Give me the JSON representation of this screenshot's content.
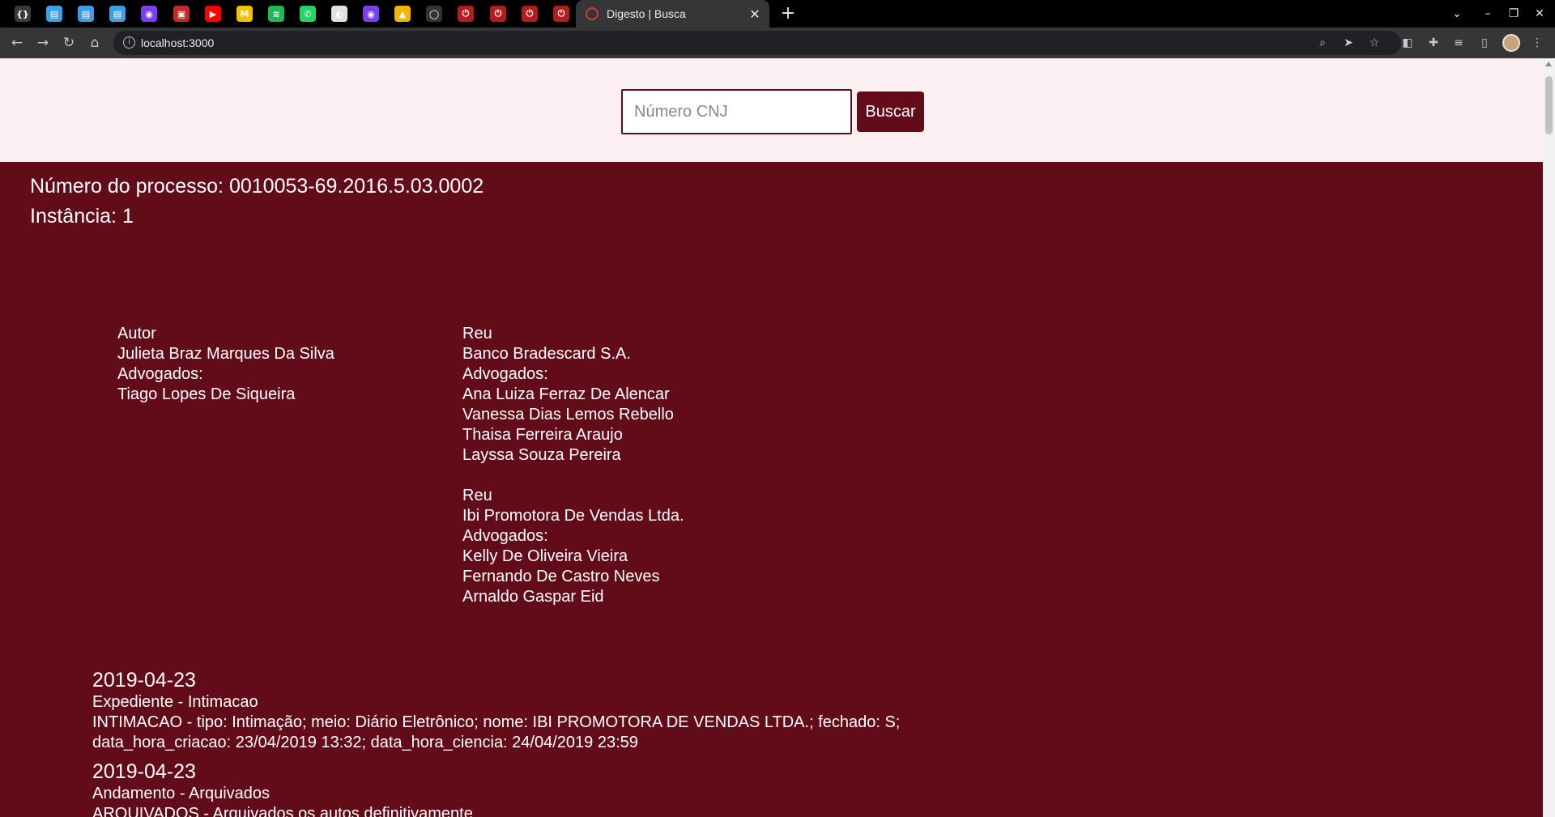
{
  "browser": {
    "pinned_tabs": [
      {
        "icon": "devtools-icon",
        "color": "#3a3a3a",
        "glyph": "{}"
      },
      {
        "icon": "docs-icon",
        "color": "#3aa0e8",
        "glyph": "▤"
      },
      {
        "icon": "docs-icon",
        "color": "#3aa0e8",
        "glyph": "▤"
      },
      {
        "icon": "docs-icon",
        "color": "#3aa0e8",
        "glyph": "▤"
      },
      {
        "icon": "purple-app-icon",
        "color": "#7b3ff2",
        "glyph": "◉"
      },
      {
        "icon": "red-app-icon",
        "color": "#c62828",
        "glyph": "▣"
      },
      {
        "icon": "youtube-icon",
        "color": "#ff0000",
        "glyph": "▶"
      },
      {
        "icon": "yellow-app-icon",
        "color": "#f2c200",
        "glyph": "M"
      },
      {
        "icon": "spotify-icon",
        "color": "#1db954",
        "glyph": "≋"
      },
      {
        "icon": "whatsapp-icon",
        "color": "#25d366",
        "glyph": "✆"
      },
      {
        "icon": "globe-icon",
        "color": "#e0e0e0",
        "glyph": "◐"
      },
      {
        "icon": "purple-app-icon",
        "color": "#7b3ff2",
        "glyph": "◉"
      },
      {
        "icon": "drive-icon",
        "color": "#f4b400",
        "glyph": "▲"
      },
      {
        "icon": "github-icon",
        "color": "#333333",
        "glyph": "◯"
      },
      {
        "icon": "power-icon",
        "color": "#b71c1c",
        "glyph": "⏻"
      },
      {
        "icon": "power-icon",
        "color": "#b71c1c",
        "glyph": "⏻"
      },
      {
        "icon": "power-icon",
        "color": "#b71c1c",
        "glyph": "⏻"
      },
      {
        "icon": "power-icon",
        "color": "#b71c1c",
        "glyph": "⏻"
      }
    ],
    "active_tab_title": "Digesto | Busca",
    "url": "localhost:3000"
  },
  "search": {
    "placeholder": "Número CNJ",
    "button_label": "Buscar"
  },
  "process": {
    "number_line": "Número do processo: 0010053-69.2016.5.03.0002",
    "instance_line": "Instância: 1"
  },
  "parties": {
    "autor": {
      "role": "Autor",
      "name": "Julieta Braz Marques Da Silva",
      "lawyers_label": "Advogados:",
      "lawyers": [
        "Tiago Lopes De Siqueira"
      ]
    },
    "reus": [
      {
        "role": "Reu",
        "name": "Banco Bradescard S.A.",
        "lawyers_label": "Advogados:",
        "lawyers": [
          "Ana Luiza Ferraz De Alencar",
          "Vanessa Dias Lemos Rebello",
          "Thaisa Ferreira Araujo",
          "Layssa Souza Pereira"
        ]
      },
      {
        "role": "Reu",
        "name": "Ibi Promotora De Vendas Ltda.",
        "lawyers_label": "Advogados:",
        "lawyers": [
          "Kelly De Oliveira Vieira",
          "Fernando De Castro Neves",
          "Arnaldo Gaspar Eid"
        ]
      }
    ]
  },
  "movements": [
    {
      "date": "2019-04-23",
      "type": "Expediente - Intimacao",
      "description": "INTIMACAO - tipo: Intimação; meio: Diário Eletrônico; nome: IBI PROMOTORA DE VENDAS LTDA.; fechado: S; data_hora_criacao: 23/04/2019 13:32; data_hora_ciencia: 24/04/2019 23:59"
    },
    {
      "date": "2019-04-23",
      "type": "Andamento - Arquivados",
      "description": "ARQUIVADOS - Arquivados os autos definitivamente"
    }
  ]
}
